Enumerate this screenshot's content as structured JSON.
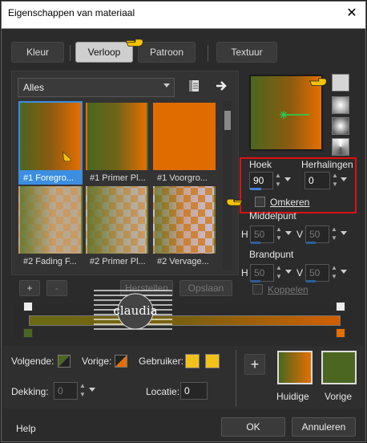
{
  "window": {
    "title": "Eigenschappen van materiaal",
    "close": "✕"
  },
  "tabs": [
    {
      "label": "Kleur",
      "active": false
    },
    {
      "label": "Verloop",
      "active": true
    },
    {
      "label": "Patroon",
      "active": false
    },
    {
      "label": "Textuur",
      "active": false
    }
  ],
  "gallery": {
    "category": "Alles",
    "items": [
      {
        "label": "#1 Foregro...",
        "style": "g-fg",
        "selected": true
      },
      {
        "label": "#1 Primer Pl...",
        "style": "g-prim",
        "selected": false
      },
      {
        "label": "#1 Voorgro...",
        "style": "g-voor",
        "selected": false
      },
      {
        "label": "#2 Fading F...",
        "style": "g-check",
        "selected": false
      },
      {
        "label": "#2 Primer Pl...",
        "style": "g-check2",
        "selected": false
      },
      {
        "label": "#2 Vervage...",
        "style": "g-check3",
        "selected": false
      }
    ],
    "add": "+",
    "remove": "-",
    "reset": "Herstellen",
    "save": "Opslaan"
  },
  "settings": {
    "angle_label": "Hoek",
    "angle_value": "90",
    "repeats_label": "Herhalingen",
    "repeats_value": "0",
    "invert_label": "Omkeren",
    "center_label": "Middelpunt",
    "center_h": "50",
    "center_v": "50",
    "focal_label": "Brandpunt",
    "focal_h": "50",
    "focal_v": "50",
    "h": "H",
    "v": "V",
    "link_label": "Koppelen"
  },
  "editor": {
    "next_label": "Volgende:",
    "prev_label": "Vorige:",
    "user_label": "Gebruiker:",
    "opacity_label": "Dekking:",
    "opacity_value": "0",
    "location_label": "Locatie:",
    "location_value": "0",
    "plus": "+",
    "current_label": "Huidige",
    "previous_label": "Vorige"
  },
  "footer": {
    "help": "Help",
    "ok": "OK",
    "cancel": "Annuleren"
  },
  "watermark": "claudia",
  "colors": {
    "accent": "#3b8ee0",
    "highlight": "#dd1111",
    "green": "#4b6620",
    "orange": "#e56f00",
    "user": "#f2c21a"
  }
}
